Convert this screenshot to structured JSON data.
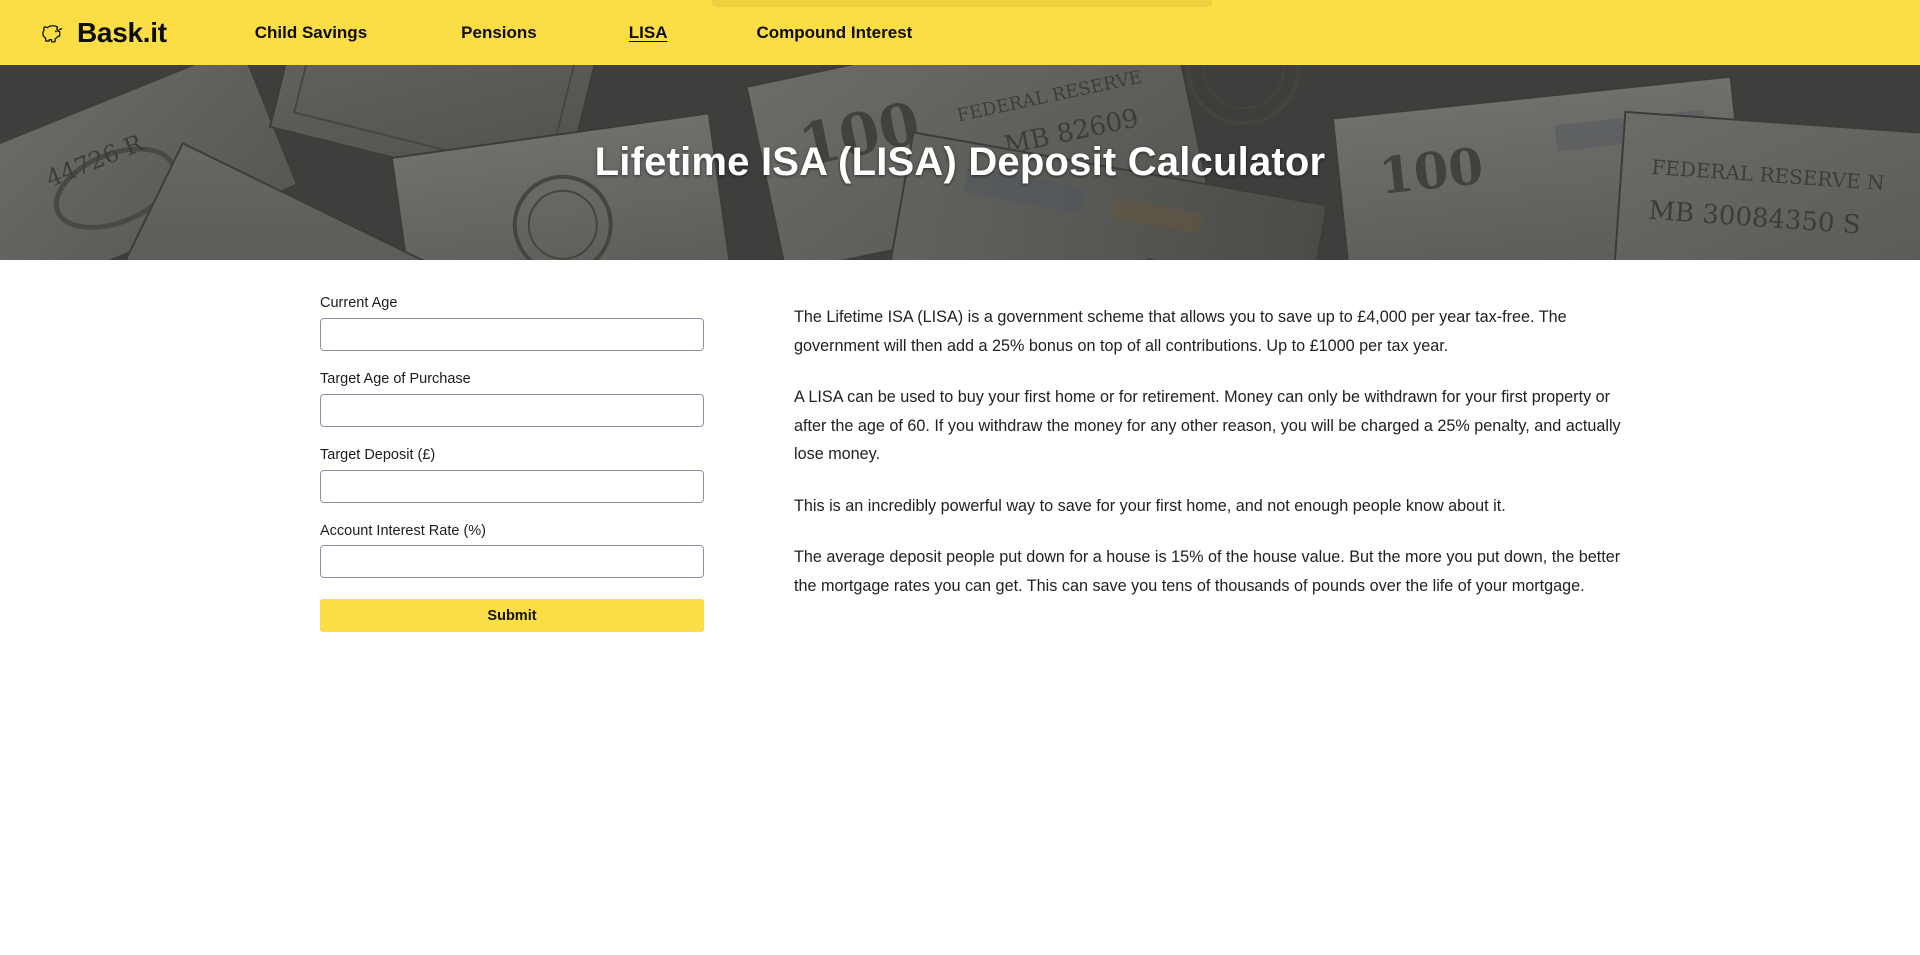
{
  "brand": {
    "name": "Bask.it",
    "icon": "piggy-bank-icon"
  },
  "nav": {
    "links": [
      {
        "label": "Child Savings",
        "active": false
      },
      {
        "label": "Pensions",
        "active": false
      },
      {
        "label": "LISA",
        "active": true
      },
      {
        "label": "Compound Interest",
        "active": false
      }
    ]
  },
  "hero": {
    "title": "Lifetime ISA (LISA) Deposit Calculator",
    "background": "hundred-dollar-bills-photo"
  },
  "form": {
    "fields": [
      {
        "label": "Current Age",
        "value": "",
        "placeholder": ""
      },
      {
        "label": "Target Age of Purchase",
        "value": "",
        "placeholder": ""
      },
      {
        "label": "Target Deposit (£)",
        "value": "",
        "placeholder": ""
      },
      {
        "label": "Account Interest Rate (%)",
        "value": "",
        "placeholder": ""
      }
    ],
    "submit_label": "Submit"
  },
  "info": {
    "paragraphs": [
      "The Lifetime ISA (LISA) is a government scheme that allows you to save up to £4,000 per year tax-free. The government will then add a 25% bonus on top of all contributions. Up to £1000 per tax year.",
      "A LISA can be used to buy your first home or for retirement. Money can only be withdrawn for your first property or after the age of 60. If you withdraw the money for any other reason, you will be charged a 25% penalty, and actually lose money.",
      "This is an incredibly powerful way to save for your first home, and not enough people know about it.",
      "The average deposit people put down for a house is 15% of the house value. But the more you put down, the better the mortgage rates you can get. This can save you tens of thousands of pounds over the life of your mortgage."
    ]
  },
  "colors": {
    "brand_yellow": "#fbdd45",
    "text_dark": "#121212",
    "input_border": "#8d92a3",
    "hero_overlay": "rgba(22,24,26,0.55)"
  }
}
